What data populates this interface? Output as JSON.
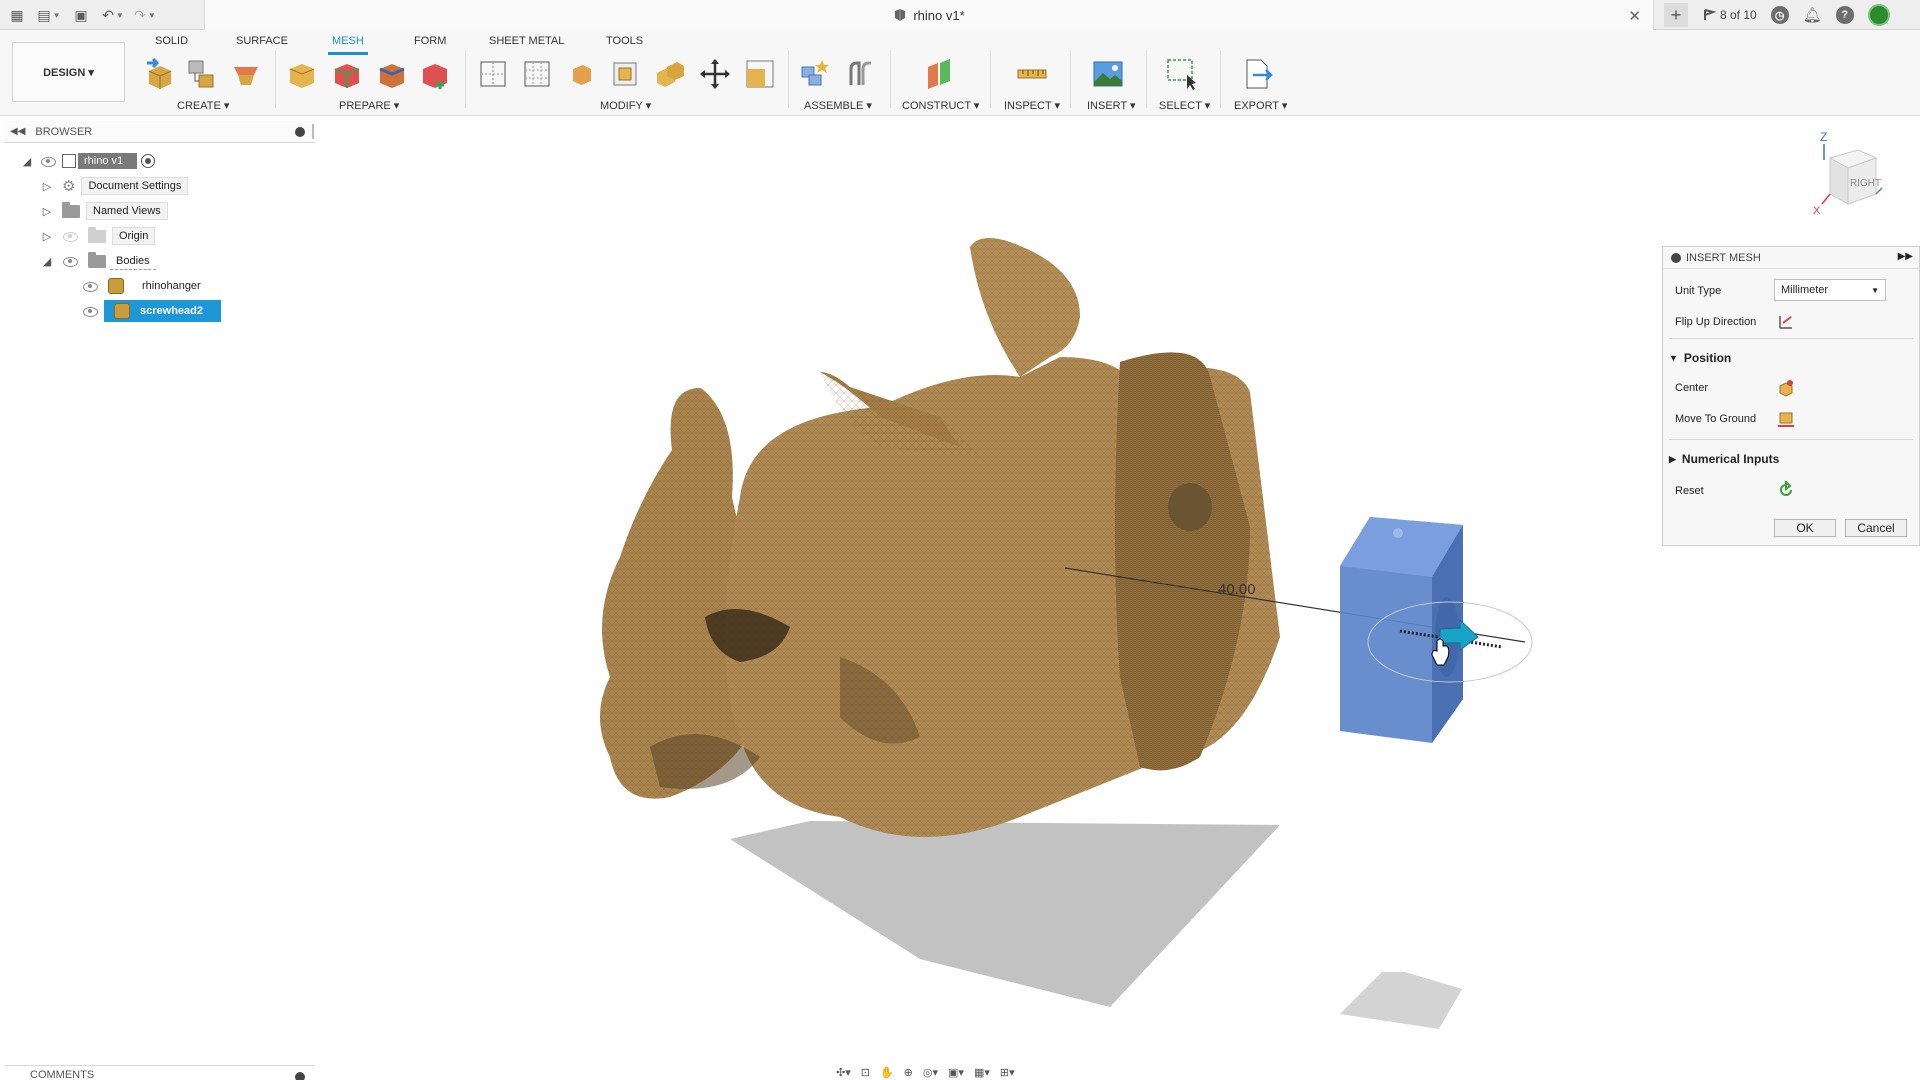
{
  "titlebar": {
    "doc_title": "rhino v1*",
    "jobs_text": "8 of 10",
    "help_symbol": "?"
  },
  "ribbon": {
    "workspace_label": "DESIGN ▾",
    "tabs": [
      "SOLID",
      "SURFACE",
      "MESH",
      "FORM",
      "SHEET METAL",
      "TOOLS"
    ],
    "active_tab": "MESH",
    "groups": [
      "CREATE ▾",
      "PREPARE ▾",
      "MODIFY ▾",
      "ASSEMBLE ▾",
      "CONSTRUCT ▾",
      "INSPECT ▾",
      "INSERT ▾",
      "SELECT ▾",
      "EXPORT ▾"
    ]
  },
  "browser": {
    "title": "BROWSER",
    "items": [
      {
        "label": "rhino v1"
      },
      {
        "label": "Document Settings"
      },
      {
        "label": "Named Views"
      },
      {
        "label": "Origin"
      },
      {
        "label": "Bodies"
      },
      {
        "label": "rhinohanger"
      },
      {
        "label": "screwhead2"
      }
    ]
  },
  "comments": {
    "title": "COMMENTS"
  },
  "canvas": {
    "dimension_value": "40.00",
    "viewcube_face": "RIGHT",
    "axis_z": "Z",
    "axis_x": "X"
  },
  "dialog": {
    "title": "INSERT MESH",
    "unit_type_label": "Unit Type",
    "unit_type_value": "Millimeter",
    "flip_up_label": "Flip Up Direction",
    "position_section": "Position",
    "center_label": "Center",
    "move_to_ground_label": "Move To Ground",
    "numerical_inputs_section": "Numerical Inputs",
    "reset_label": "Reset",
    "ok_label": "OK",
    "cancel_label": "Cancel"
  },
  "colors": {
    "accent": "#1a8fd6",
    "selection": "#1e97d8",
    "mesh_tan": "#b08a53",
    "body_blue": "#5b84c9"
  }
}
